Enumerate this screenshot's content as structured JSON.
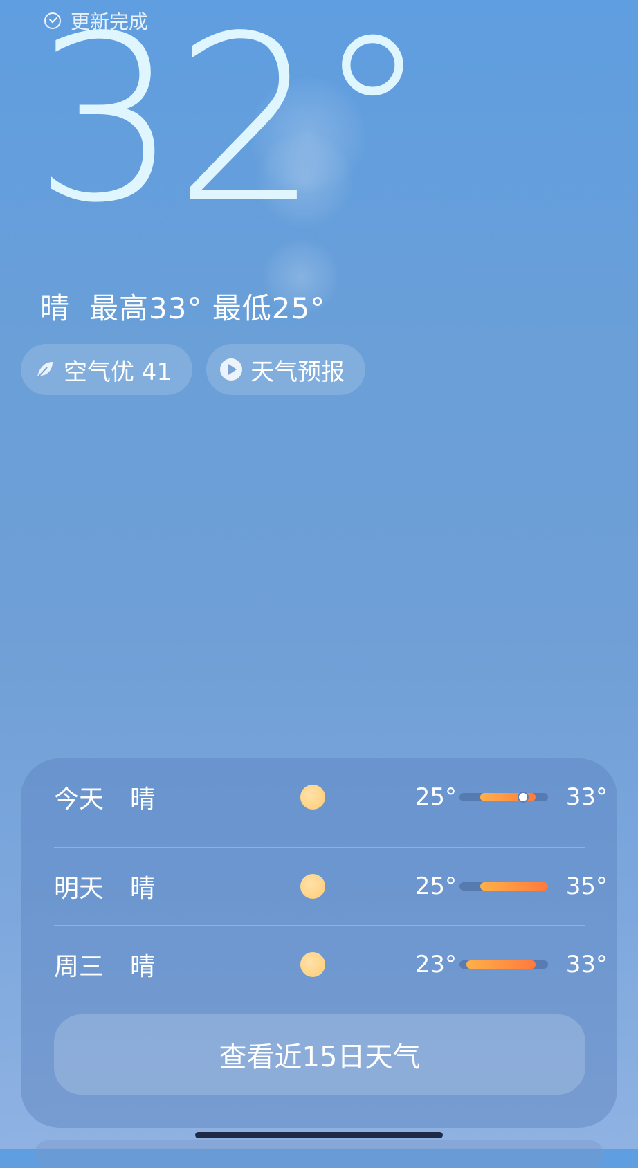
{
  "status": {
    "text": "更新完成"
  },
  "current": {
    "temperature": "32°",
    "condition": "晴",
    "high_low": "最高33° 最低25°"
  },
  "chips": {
    "air": "空气优 41",
    "forecast": "天气预报"
  },
  "forecast": {
    "rows": [
      {
        "day": "今天",
        "condition": "晴",
        "icon": "sun-icon",
        "low": "25°",
        "high": "33°",
        "current_temp": 32
      },
      {
        "day": "明天",
        "condition": "晴",
        "icon": "sun-icon",
        "low": "25°",
        "high": "35°"
      },
      {
        "day": "周三",
        "condition": "晴",
        "icon": "sun-icon",
        "low": "23°",
        "high": "33°"
      }
    ],
    "view_more": "查看近15日天气"
  },
  "colors": {
    "accent_bar_start": "#ffb04a",
    "accent_bar_end": "#ff7a3c",
    "sun": "#ffcc74"
  }
}
